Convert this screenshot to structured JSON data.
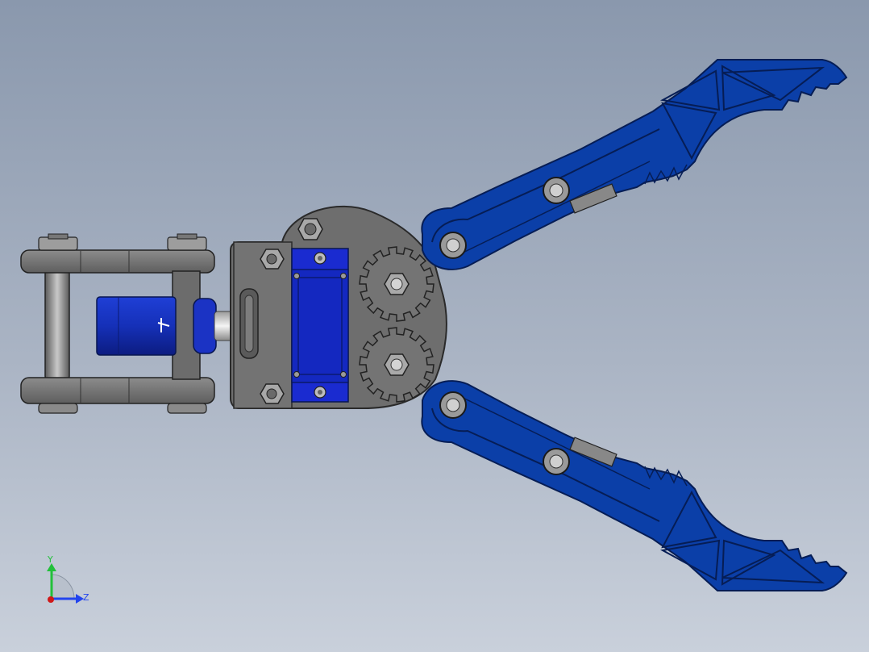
{
  "scene": {
    "colors": {
      "background_top": "#8a98ad",
      "background_mid": "#aab4c4",
      "background_bottom": "#c9d0db",
      "jaw_blue": "#0b3fa8",
      "jaw_edge": "#061d55",
      "servo_blue": "#1a2bd0",
      "metal_grey": "#707070",
      "metal_dark": "#2d2d2d",
      "nut_grey": "#9a9a9a"
    },
    "parts": [
      "base-bracket",
      "motor",
      "servo-mount-plate",
      "gear-upper",
      "gear-lower",
      "jaw-upper",
      "jaw-lower"
    ]
  },
  "triad": {
    "y_label": "Y",
    "z_label": "Z",
    "y_color": "#22c03a",
    "z_color": "#2244ee",
    "x_color": "#d01818"
  }
}
